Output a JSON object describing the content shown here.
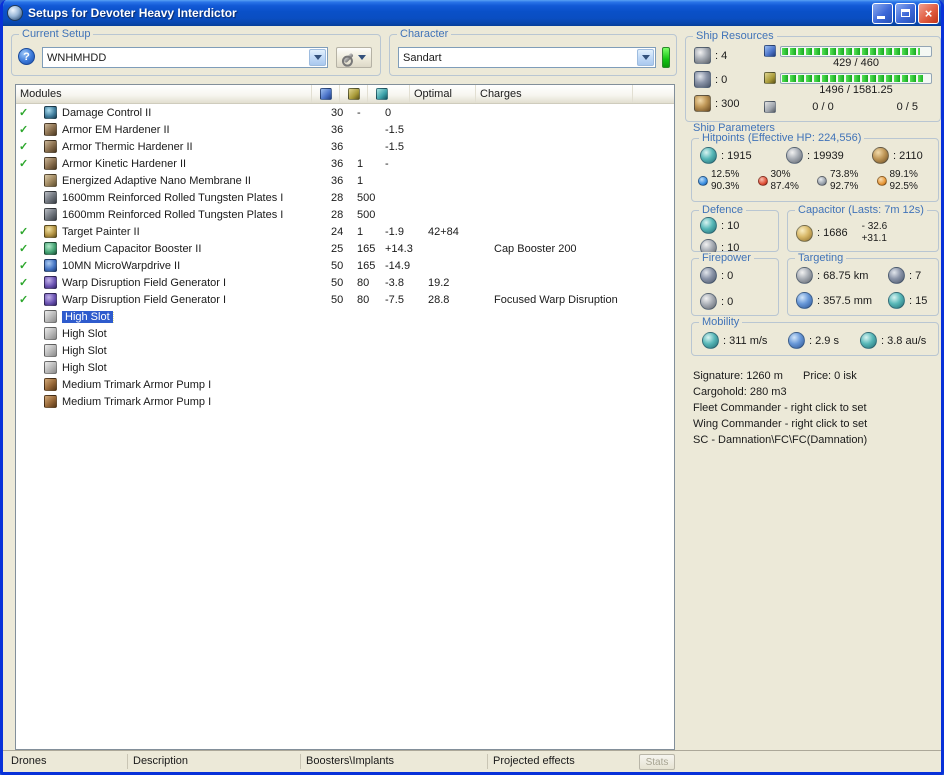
{
  "window": {
    "title": "Setups for Devoter Heavy Interdictor"
  },
  "glyphs": {
    "help": "?",
    "check": "✓",
    "close": "×"
  },
  "setup": {
    "label": "Current Setup",
    "value": "WNHMHDD"
  },
  "character": {
    "label": "Character",
    "value": "Sandart"
  },
  "table": {
    "modules_header": "Modules",
    "optimal_header": "Optimal",
    "charges_header": "Charges",
    "rows": [
      {
        "checked": true,
        "selected": false,
        "icon": "damage-control",
        "name": "Damage Control II",
        "cpu": "30",
        "pg": "-",
        "cap": "0",
        "optimal": "",
        "charges": ""
      },
      {
        "checked": true,
        "selected": false,
        "icon": "armor-hardener",
        "name": "Armor EM Hardener II",
        "cpu": "36",
        "pg": "",
        "cap": "-1.5",
        "optimal": "",
        "charges": ""
      },
      {
        "checked": true,
        "selected": false,
        "icon": "armor-hardener",
        "name": "Armor Thermic Hardener II",
        "cpu": "36",
        "pg": "",
        "cap": "-1.5",
        "optimal": "",
        "charges": ""
      },
      {
        "checked": true,
        "selected": false,
        "icon": "armor-hardener",
        "name": "Armor Kinetic Hardener II",
        "cpu": "36",
        "pg": "1",
        "cap": "-",
        "optimal": "",
        "charges": ""
      },
      {
        "checked": false,
        "selected": false,
        "icon": "armor-membrane",
        "name": "Energized Adaptive Nano Membrane II",
        "cpu": "36",
        "pg": "1",
        "cap": "",
        "optimal": "",
        "charges": ""
      },
      {
        "checked": false,
        "selected": false,
        "icon": "armor-plate",
        "name": "1600mm Reinforced Rolled Tungsten Plates I",
        "cpu": "28",
        "pg": "500",
        "cap": "",
        "optimal": "",
        "charges": ""
      },
      {
        "checked": false,
        "selected": false,
        "icon": "armor-plate",
        "name": "1600mm Reinforced Rolled Tungsten Plates I",
        "cpu": "28",
        "pg": "500",
        "cap": "",
        "optimal": "",
        "charges": ""
      },
      {
        "checked": true,
        "selected": false,
        "icon": "target-painter",
        "name": "Target Painter II",
        "cpu": "24",
        "pg": "1",
        "cap": "-1.9",
        "optimal": "42+84",
        "charges": ""
      },
      {
        "checked": true,
        "selected": false,
        "icon": "cap-booster",
        "name": "Medium Capacitor Booster II",
        "cpu": "25",
        "pg": "165",
        "cap": "+14.3",
        "optimal": "",
        "charges": "Cap Booster 200"
      },
      {
        "checked": true,
        "selected": false,
        "icon": "mwd",
        "name": "10MN MicroWarpdrive II",
        "cpu": "50",
        "pg": "165",
        "cap": "-14.9",
        "optimal": "",
        "charges": ""
      },
      {
        "checked": true,
        "selected": false,
        "icon": "wdfg",
        "name": "Warp Disruption Field Generator I",
        "cpu": "50",
        "pg": "80",
        "cap": "-3.8",
        "optimal": "19.2",
        "charges": ""
      },
      {
        "checked": true,
        "selected": false,
        "icon": "wdfg",
        "name": "Warp Disruption Field Generator I",
        "cpu": "50",
        "pg": "80",
        "cap": "-7.5",
        "optimal": "28.8",
        "charges": "Focused Warp Disruption"
      },
      {
        "checked": false,
        "selected": true,
        "icon": "empty-slot",
        "name": "High Slot",
        "cpu": "",
        "pg": "",
        "cap": "",
        "optimal": "",
        "charges": ""
      },
      {
        "checked": false,
        "selected": false,
        "icon": "empty-slot",
        "name": "High Slot",
        "cpu": "",
        "pg": "",
        "cap": "",
        "optimal": "",
        "charges": ""
      },
      {
        "checked": false,
        "selected": false,
        "icon": "empty-slot",
        "name": "High Slot",
        "cpu": "",
        "pg": "",
        "cap": "",
        "optimal": "",
        "charges": ""
      },
      {
        "checked": false,
        "selected": false,
        "icon": "empty-slot",
        "name": "High Slot",
        "cpu": "",
        "pg": "",
        "cap": "",
        "optimal": "",
        "charges": ""
      },
      {
        "checked": false,
        "selected": false,
        "icon": "rig",
        "name": "Medium Trimark Armor Pump I",
        "cpu": "",
        "pg": "",
        "cap": "",
        "optimal": "",
        "charges": ""
      },
      {
        "checked": false,
        "selected": false,
        "icon": "rig",
        "name": "Medium Trimark Armor Pump I",
        "cpu": "",
        "pg": "",
        "cap": "",
        "optimal": "",
        "charges": ""
      }
    ]
  },
  "tabs": {
    "drones": "Drones",
    "description": "Description",
    "boosters": "Boosters\\Implants",
    "projected": "Projected effects",
    "stats": "Stats"
  },
  "resources": {
    "label": "Ship Resources",
    "turrets": ": 4",
    "launchers": ": 0",
    "calibration": ": 300",
    "cpu_text": "429 / 460",
    "cpu_pct": 93,
    "pg_text": "1496 / 1581.25",
    "pg_pct": 95,
    "drone_bay": "0 / 0",
    "drone_slots": "0 / 5"
  },
  "parameters": {
    "label": "Ship Parameters",
    "hitpoints": {
      "label": "Hitpoints (Effective HP: 224,556)",
      "shield": ": 1915",
      "armor": ": 19939",
      "hull": ": 2110",
      "resists": [
        {
          "shield": "12.5%",
          "armor": "90.3%"
        },
        {
          "shield": "30%",
          "armor": "87.4%"
        },
        {
          "shield": "73.8%",
          "armor": "92.7%"
        },
        {
          "shield": "89.1%",
          "armor": "92.5%"
        }
      ]
    },
    "defence": {
      "label": "Defence",
      "row1": ": 10",
      "row2": ": 10"
    },
    "capacitor": {
      "label": "Capacitor (Lasts: 7m 12s)",
      "amount": ": 1686",
      "drain": "- 32.6",
      "recharge": "+31.1"
    },
    "firepower": {
      "label": "Firepower",
      "row1": ": 0",
      "row2": ": 0"
    },
    "targeting": {
      "label": "Targeting",
      "range": ": 68.75 km",
      "max_targets": ": 7",
      "scan_res": ": 357.5 mm",
      "sensor_strength": ": 15"
    },
    "mobility": {
      "label": "Mobility",
      "speed": ": 311 m/s",
      "agility": ": 2.9 s",
      "warp_speed": ": 3.8 au/s"
    },
    "info": {
      "signature": "Signature: 1260 m",
      "price": "Price: 0 isk",
      "cargohold": "Cargohold: 280 m3",
      "fleet_commander": "Fleet Commander - right click to set",
      "wing_commander": "Wing Commander - right click to set",
      "squad_commander": "SC - Damnation\\FC\\FC(Damnation)"
    }
  }
}
